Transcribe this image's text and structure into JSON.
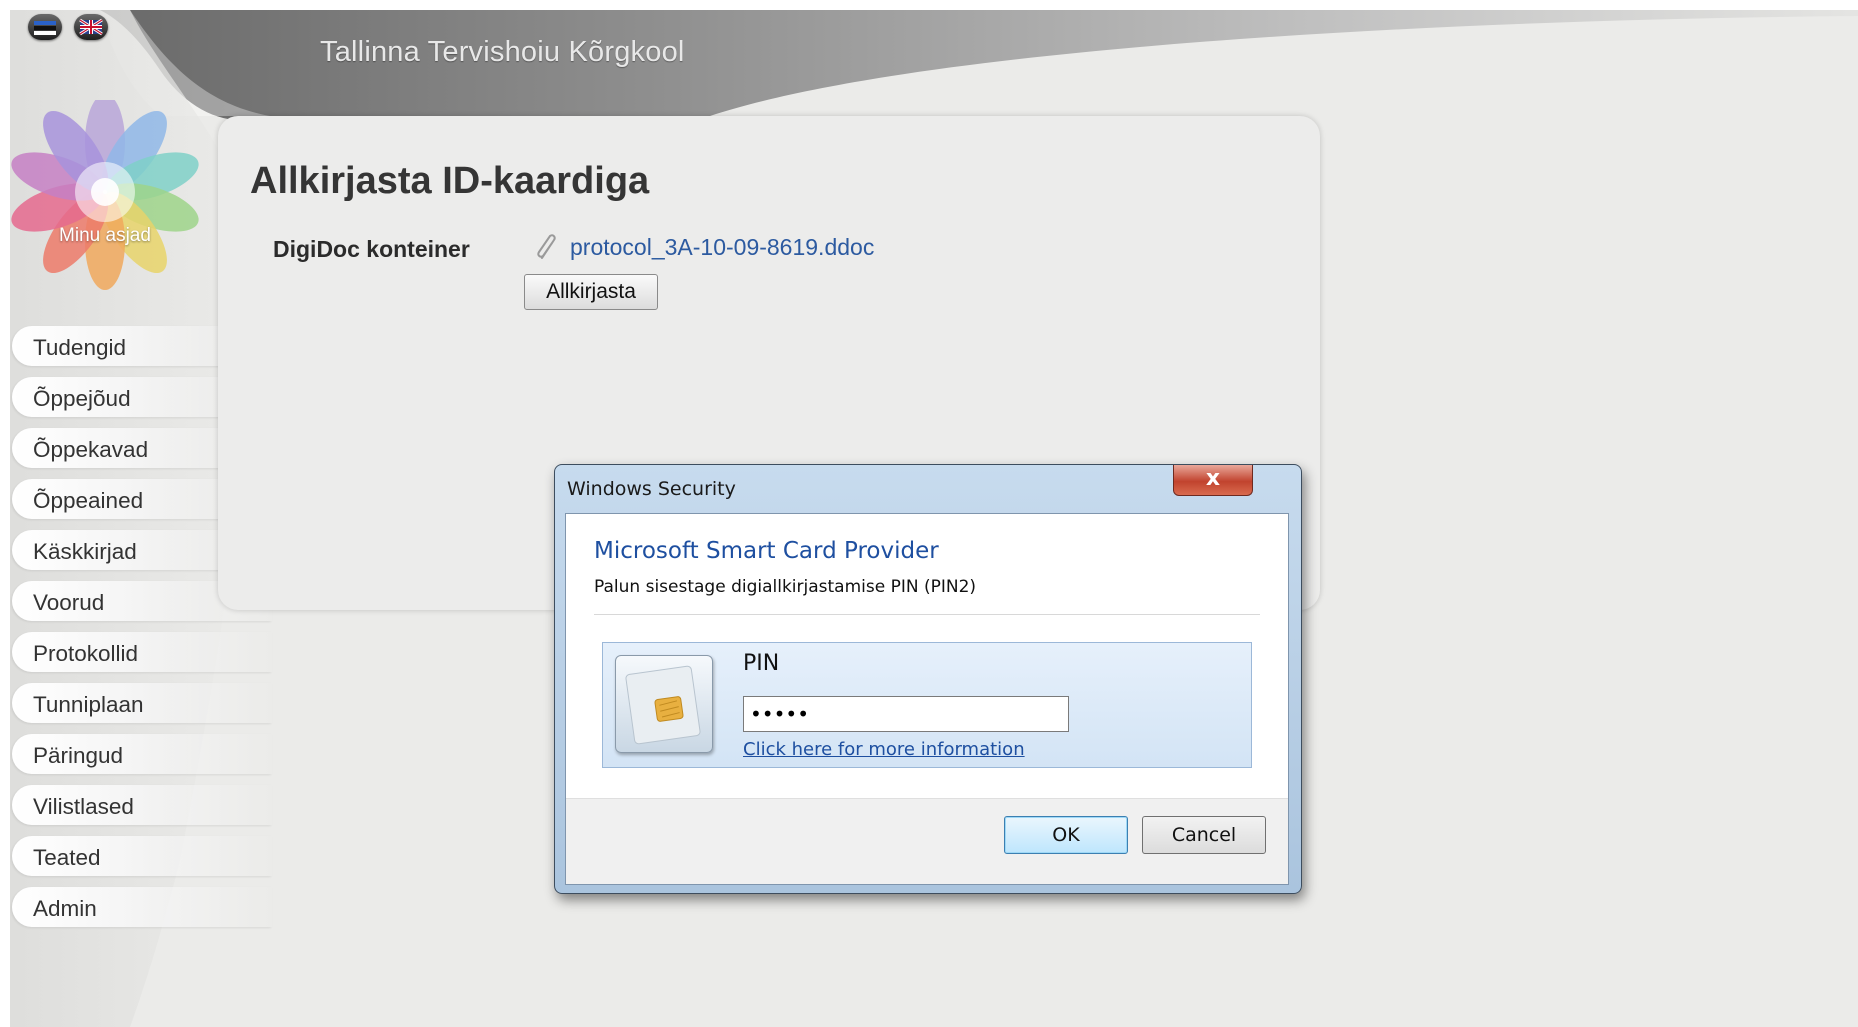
{
  "site": {
    "title": "Tallinna Tervishoiu Kõrgkool"
  },
  "languages": [
    "estonian-flag-icon",
    "uk-flag-icon"
  ],
  "logo": {
    "label": "Minu asjad"
  },
  "nav": {
    "items": [
      {
        "label": "Tudengid"
      },
      {
        "label": "Õppejõud"
      },
      {
        "label": "Õppekavad"
      },
      {
        "label": "Õppeained"
      },
      {
        "label": "Käskkirjad"
      },
      {
        "label": "Voorud"
      },
      {
        "label": "Protokollid"
      },
      {
        "label": "Tunniplaan"
      },
      {
        "label": "Päringud"
      },
      {
        "label": "Vilistlased"
      },
      {
        "label": "Teated"
      },
      {
        "label": "Admin"
      }
    ]
  },
  "main": {
    "title": "Allkirjasta ID-kaardiga",
    "container_label": "DigiDoc konteiner",
    "file_icon": "paperclip-icon",
    "file_name": "protocol_3A-10-09-8619.ddoc",
    "sign_button": "Allkirjasta"
  },
  "dialog": {
    "title": "Windows Security",
    "close_label": "x",
    "provider": "Microsoft Smart Card Provider",
    "prompt": "Palun sisestage digiallkirjastamise PIN (PIN2)",
    "credential_icon": "smart-card-icon",
    "pin_label": "PIN",
    "pin_value": "•••••",
    "more_info": "Click here for more information",
    "ok": "OK",
    "cancel": "Cancel"
  },
  "colors": {
    "background": "#ebebe9",
    "header_gray": "#6f6f6f",
    "link_blue": "#2c5aa0",
    "dialog_blue": "#b6cde4",
    "close_red": "#c1432e"
  }
}
